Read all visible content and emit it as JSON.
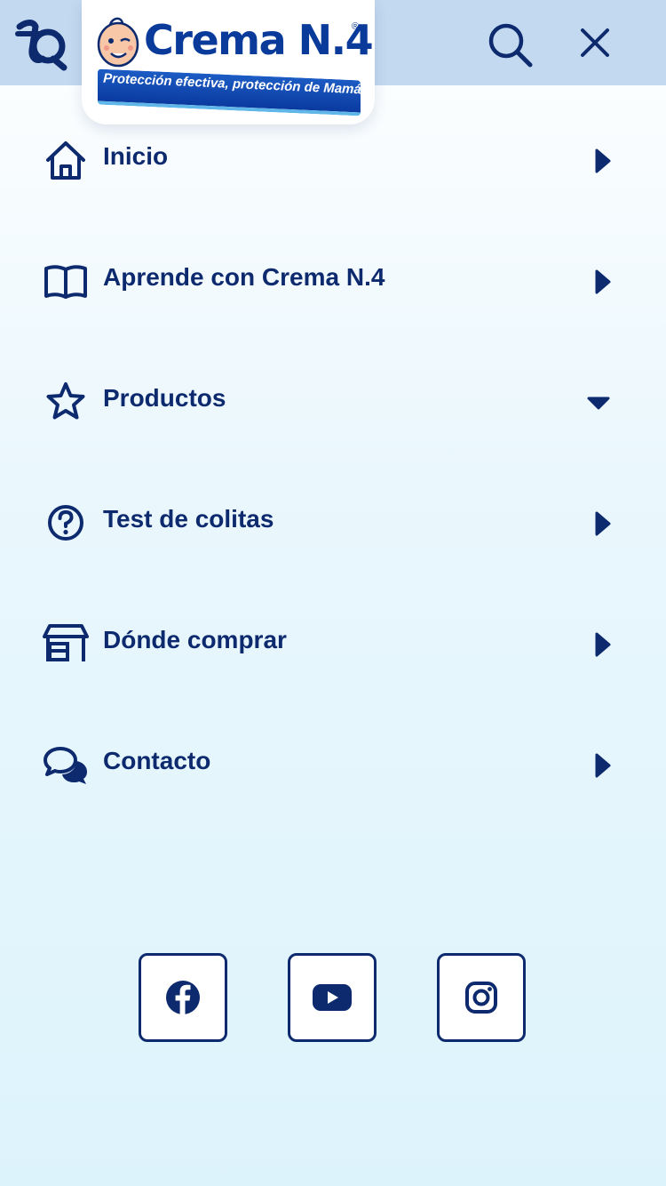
{
  "header": {
    "brand_name": "Crema N.4",
    "registered_mark": "®",
    "tagline": "Protección efectiva, protección de Mamá"
  },
  "menu": {
    "items": [
      {
        "label": "Inicio",
        "icon": "home-icon",
        "indicator": "chevron-right"
      },
      {
        "label": "Aprende con Crema N.4",
        "icon": "book-icon",
        "indicator": "chevron-right"
      },
      {
        "label": "Productos",
        "icon": "star-icon",
        "indicator": "chevron-down"
      },
      {
        "label": "Test de colitas",
        "icon": "question-icon",
        "indicator": "chevron-right"
      },
      {
        "label": "Dónde comprar",
        "icon": "store-icon",
        "indicator": "chevron-right"
      },
      {
        "label": "Contacto",
        "icon": "chat-icon",
        "indicator": "chevron-right"
      }
    ]
  },
  "social": [
    "facebook-icon",
    "youtube-icon",
    "instagram-icon"
  ],
  "colors": {
    "primary": "#0d2a6e",
    "topbar": "#c3d9ef",
    "brand_blue": "#0a3a9a",
    "background_bottom": "#ddf3fc"
  }
}
